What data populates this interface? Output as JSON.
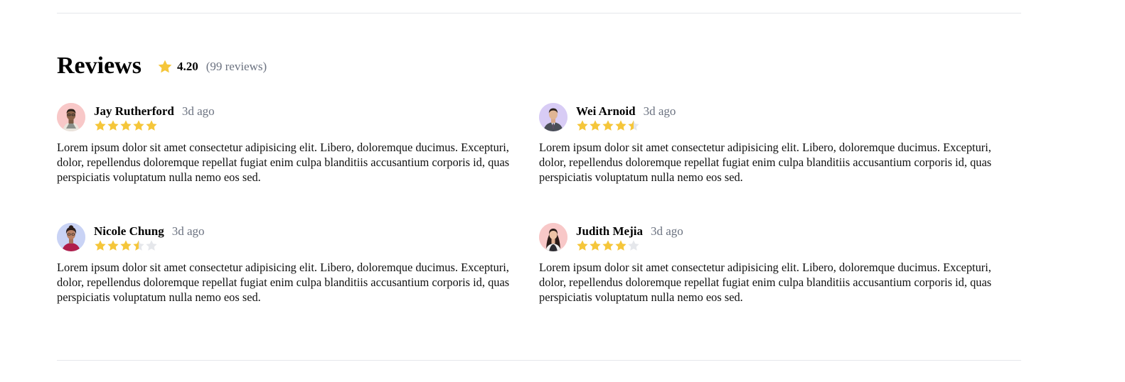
{
  "section": {
    "title": "Reviews",
    "average_rating": "4.20",
    "review_count_text": "(99 reviews)"
  },
  "colors": {
    "star_filled": "#f5c63a",
    "star_empty": "#e5e7eb",
    "divider": "#e5e7eb",
    "muted_text": "#6b7280"
  },
  "reviews": [
    {
      "name": "Jay Rutherford",
      "time": "3d ago",
      "rating": 5,
      "avatar_bg": "#f8c8c8",
      "avatar_icon": "person-photo",
      "text": "Lorem ipsum dolor sit amet consectetur adipisicing elit. Libero, doloremque ducimus. Excepturi, dolor, repellendus doloremque repellat fugiat enim culpa blanditiis accusantium corporis id, quas perspiciatis voluptatum nulla nemo eos sed."
    },
    {
      "name": "Wei Arnoid",
      "time": "3d ago",
      "rating": 4.5,
      "avatar_bg": "#d8ccf5",
      "avatar_icon": "person-photo",
      "text": "Lorem ipsum dolor sit amet consectetur adipisicing elit. Libero, doloremque ducimus. Excepturi, dolor, repellendus doloremque repellat fugiat enim culpa blanditiis accusantium corporis id, quas perspiciatis voluptatum nulla nemo eos sed."
    },
    {
      "name": "Nicole Chung",
      "time": "3d ago",
      "rating": 3.5,
      "avatar_bg": "#c9d3f5",
      "avatar_icon": "person-photo",
      "text": "Lorem ipsum dolor sit amet consectetur adipisicing elit. Libero, doloremque ducimus. Excepturi, dolor, repellendus doloremque repellat fugiat enim culpa blanditiis accusantium corporis id, quas perspiciatis voluptatum nulla nemo eos sed."
    },
    {
      "name": "Judith Mejia",
      "time": "3d ago",
      "rating": 4,
      "avatar_bg": "#f8c8c8",
      "avatar_icon": "person-photo",
      "text": "Lorem ipsum dolor sit amet consectetur adipisicing elit. Libero, doloremque ducimus. Excepturi, dolor, repellendus doloremque repellat fugiat enim culpa blanditiis accusantium corporis id, quas perspiciatis voluptatum nulla nemo eos sed."
    }
  ]
}
